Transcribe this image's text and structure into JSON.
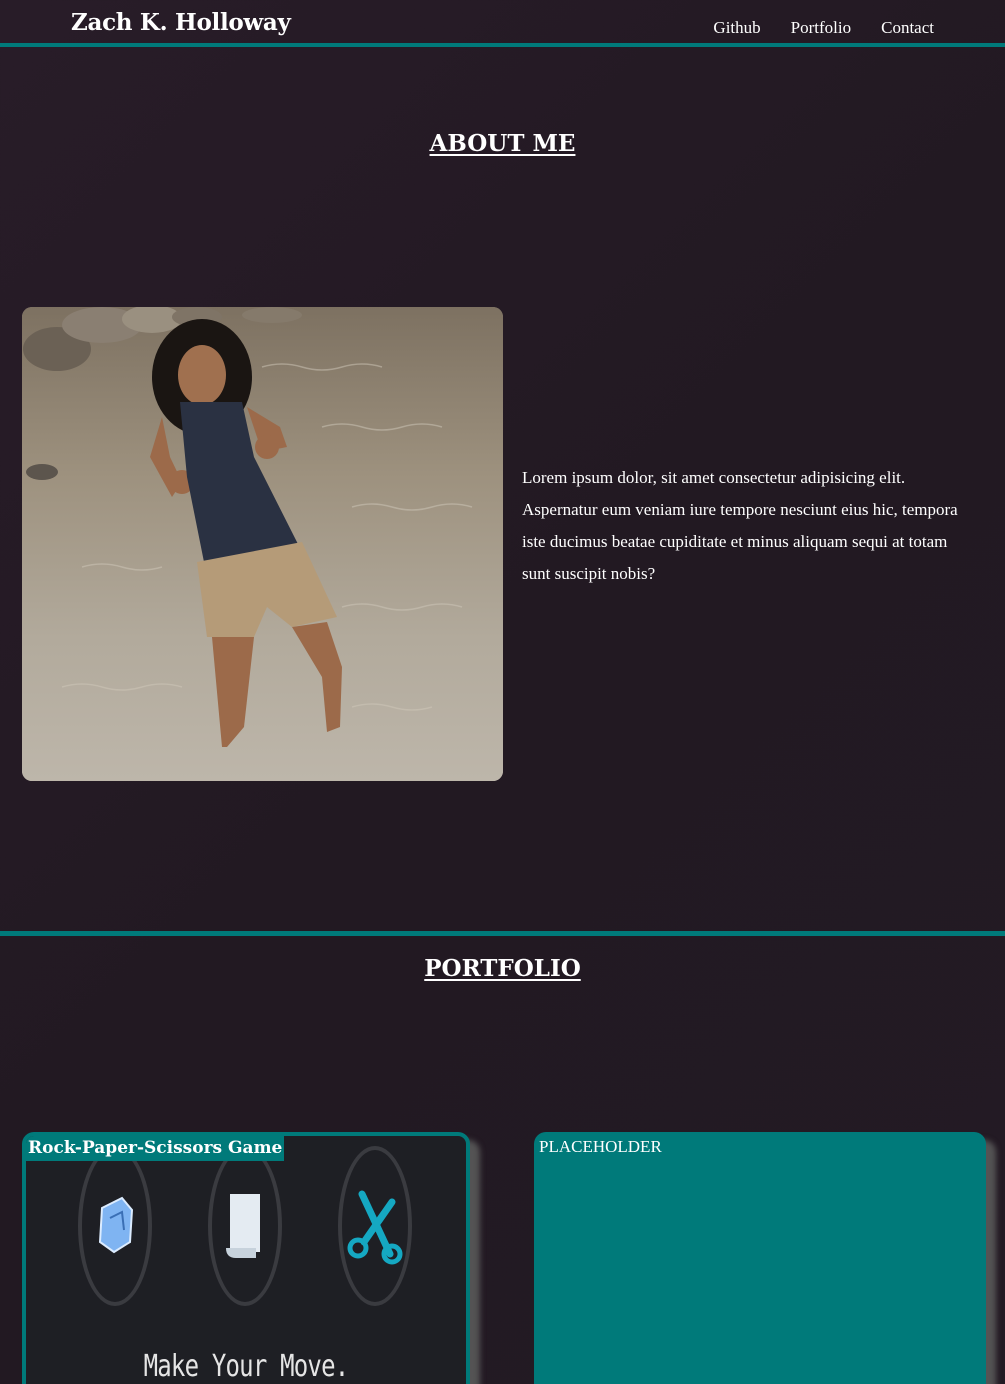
{
  "header": {
    "brand": "Zach K. Holloway",
    "nav": [
      {
        "label": "Github"
      },
      {
        "label": "Portfolio"
      },
      {
        "label": "Contact"
      }
    ]
  },
  "about": {
    "title": "ABOUT ME",
    "photo_alt": "Photo of Zach standing in a river giving thumbs up",
    "bio": "Lorem ipsum dolor, sit amet consectetur adipisicing elit. Aspernatur eum veniam iure tempore nesciunt eius hic, tempora iste ducimus beatae cupiditate et minus aliquam sequi at totam sunt suscipit nobis?"
  },
  "portfolio": {
    "title": "PORTFOLIO",
    "projects": [
      {
        "title": "Rock-Paper-Scissors Game",
        "preview_caption": "Make Your Move.",
        "choices": [
          "rock-icon",
          "paper-icon",
          "scissors-icon"
        ]
      },
      {
        "title": "PLACEHOLDER"
      }
    ]
  },
  "colors": {
    "accent": "#007a7a",
    "background": "#251b25",
    "text": "#ffffff"
  }
}
